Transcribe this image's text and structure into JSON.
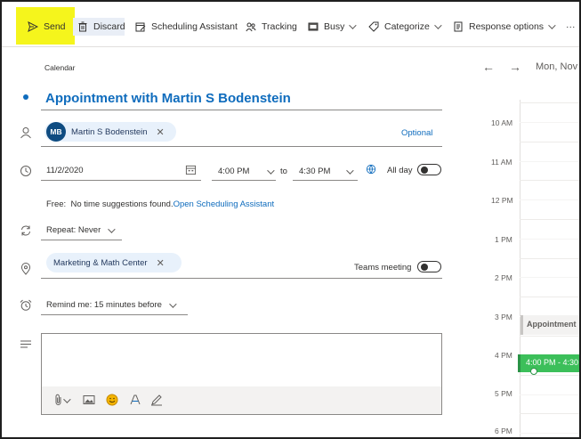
{
  "toolbar": {
    "send": "Send",
    "discard": "Discard",
    "scheduling_assistant": "Scheduling Assistant",
    "tracking": "Tracking",
    "busy": "Busy",
    "categorize": "Categorize",
    "response_options": "Response options",
    "more": "···"
  },
  "form": {
    "calendar_label": "Calendar",
    "title": "Appointment with Martin S Bodenstein",
    "attendee": {
      "initials": "MB",
      "name": "Martin S Bodenstein"
    },
    "optional_label": "Optional",
    "start_date": "11/2/2020",
    "start_time": "4:00 PM",
    "to_label": "to",
    "end_time": "4:30 PM",
    "all_day_label": "All day",
    "free_label": "Free:",
    "suggestion_text": "No time suggestions found.",
    "open_assistant_link": "Open Scheduling Assistant",
    "repeat": "Repeat: Never",
    "location": "Marketing & Math Center",
    "teams_meeting_label": "Teams meeting",
    "remind": "Remind me: 15 minutes before"
  },
  "calendar": {
    "date_header": "Mon, Nov",
    "hours": [
      "10 AM",
      "11 AM",
      "12 PM",
      "1 PM",
      "2 PM",
      "3 PM",
      "4 PM",
      "5 PM",
      "6 PM"
    ],
    "existing_event": "Appointment",
    "new_event": "4:00 PM - 4:30"
  },
  "colors": {
    "accent": "#0f6cbd",
    "send_highlight": "#f5f51c",
    "event_green": "#3cbf5a"
  }
}
